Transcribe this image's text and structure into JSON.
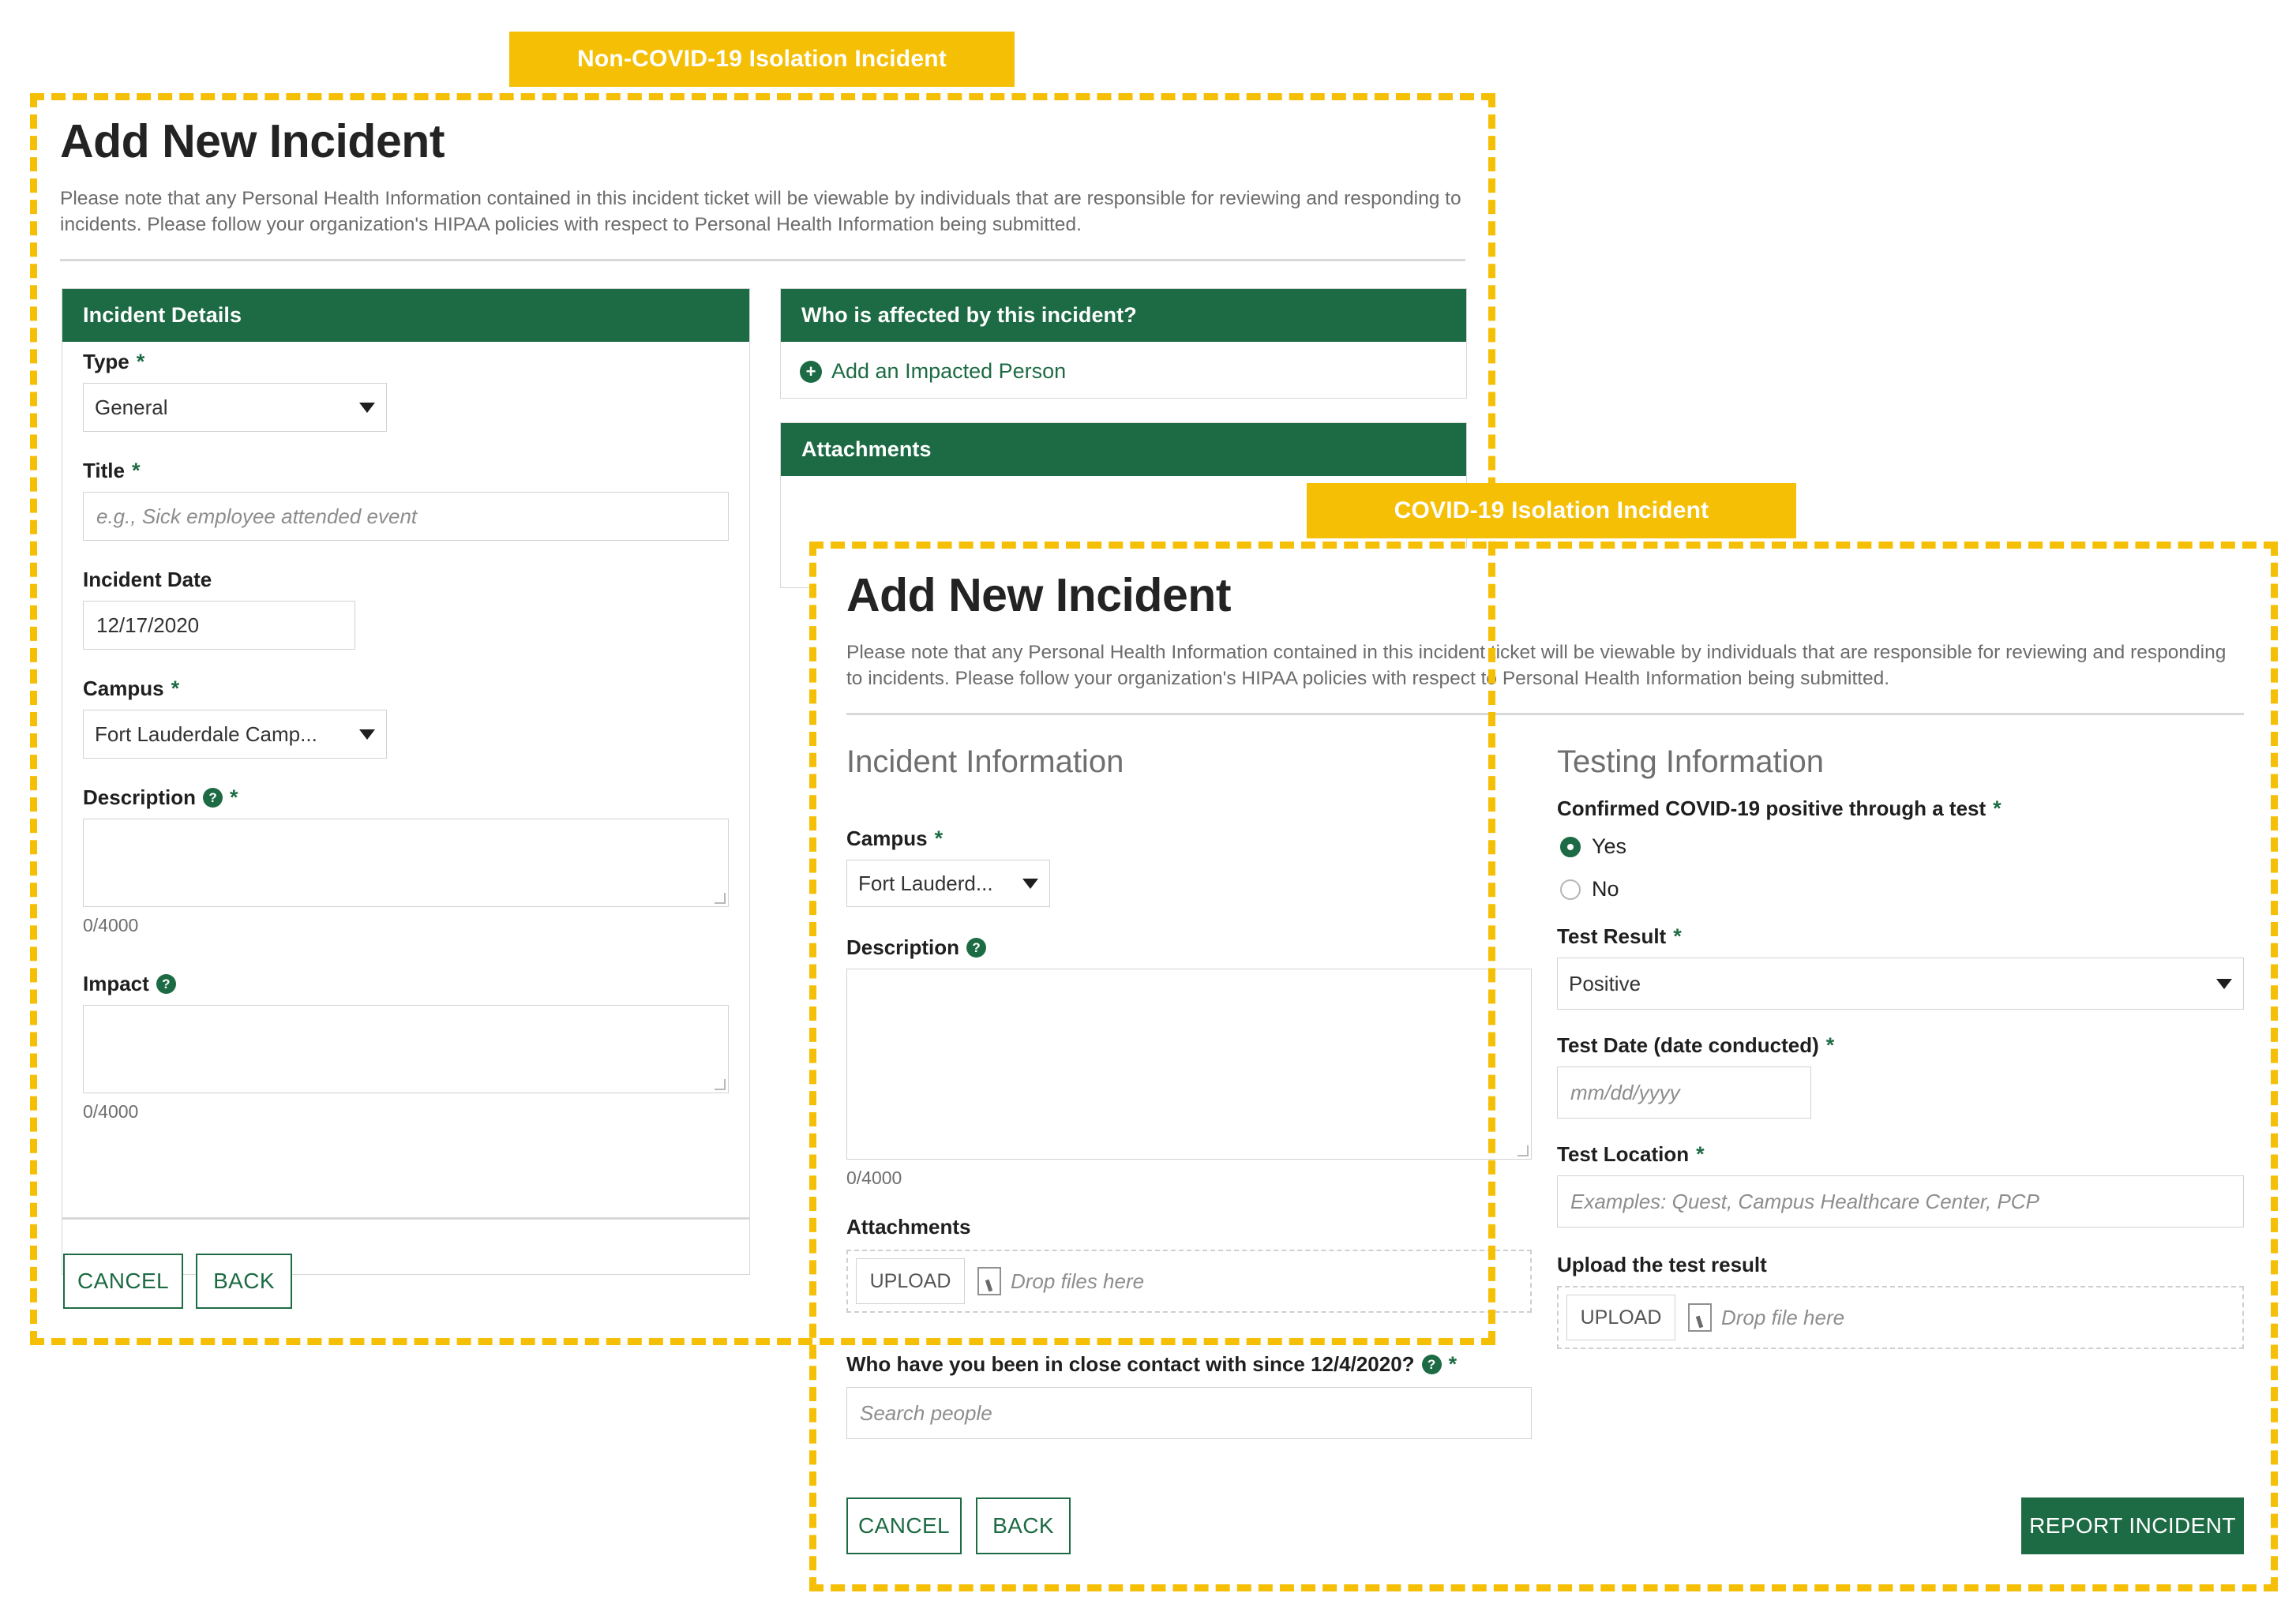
{
  "annotations": {
    "noncovid_tag": "Non-COVID-19 Isolation Incident",
    "covid_tag": "COVID-19 Isolation Incident",
    "accent_color": "#f5bf05",
    "brand_green": "#1d6b44"
  },
  "noncovid": {
    "title": "Add New Incident",
    "note": "Please note that any Personal Health Information contained in this incident ticket will be viewable by individuals that are responsible for reviewing and responding to incidents. Please follow your organization's HIPAA policies with respect to Personal Health Information being submitted.",
    "incident_details": {
      "header": "Incident Details",
      "type_label": "Type",
      "type_value": "General",
      "title_label": "Title",
      "title_placeholder": "e.g., Sick employee attended event",
      "date_label": "Incident Date",
      "date_value": "12/17/2020",
      "campus_label": "Campus",
      "campus_value": "Fort Lauderdale Camp...",
      "description_label": "Description",
      "description_counter": "0/4000",
      "impact_label": "Impact",
      "impact_counter": "0/4000",
      "required_mark": "*",
      "help_glyph": "?"
    },
    "affected": {
      "header": "Who is affected by this incident?",
      "add_person_label": "Add an Impacted Person",
      "plus_glyph": "+"
    },
    "attachments": {
      "header": "Attachments"
    },
    "footer": {
      "cancel_label": "CANCEL",
      "back_label": "BACK"
    }
  },
  "covid": {
    "title": "Add New Incident",
    "note": "Please note that any Personal Health Information contained in this incident ticket will be viewable by individuals that are responsible for reviewing and responding to incidents. Please follow your organization's HIPAA policies with respect to Personal Health Information being submitted.",
    "incident_information": {
      "section_title": "Incident Information",
      "campus_label": "Campus",
      "campus_value": "Fort Lauderd...",
      "description_label": "Description",
      "description_counter": "0/4000",
      "attachments_label": "Attachments",
      "upload_label": "UPLOAD",
      "drop_text": "Drop files here",
      "close_contact_label": "Who have you been in close contact with since 12/4/2020?",
      "close_contact_placeholder": "Search people"
    },
    "testing_information": {
      "section_title": "Testing Information",
      "confirmed_label": "Confirmed COVID-19 positive through a test",
      "yes_label": "Yes",
      "no_label": "No",
      "test_result_label": "Test Result",
      "test_result_value": "Positive",
      "test_date_label": "Test Date (date conducted)",
      "test_date_placeholder": "mm/dd/yyyy",
      "test_location_label": "Test Location",
      "test_location_placeholder": "Examples: Quest, Campus Healthcare Center, PCP",
      "upload_result_label": "Upload the test result",
      "upload_label": "UPLOAD",
      "drop_text": "Drop file here"
    },
    "footer": {
      "cancel_label": "CANCEL",
      "back_label": "BACK",
      "report_label": "REPORT INCIDENT"
    },
    "required_mark": "*",
    "help_glyph": "?"
  }
}
